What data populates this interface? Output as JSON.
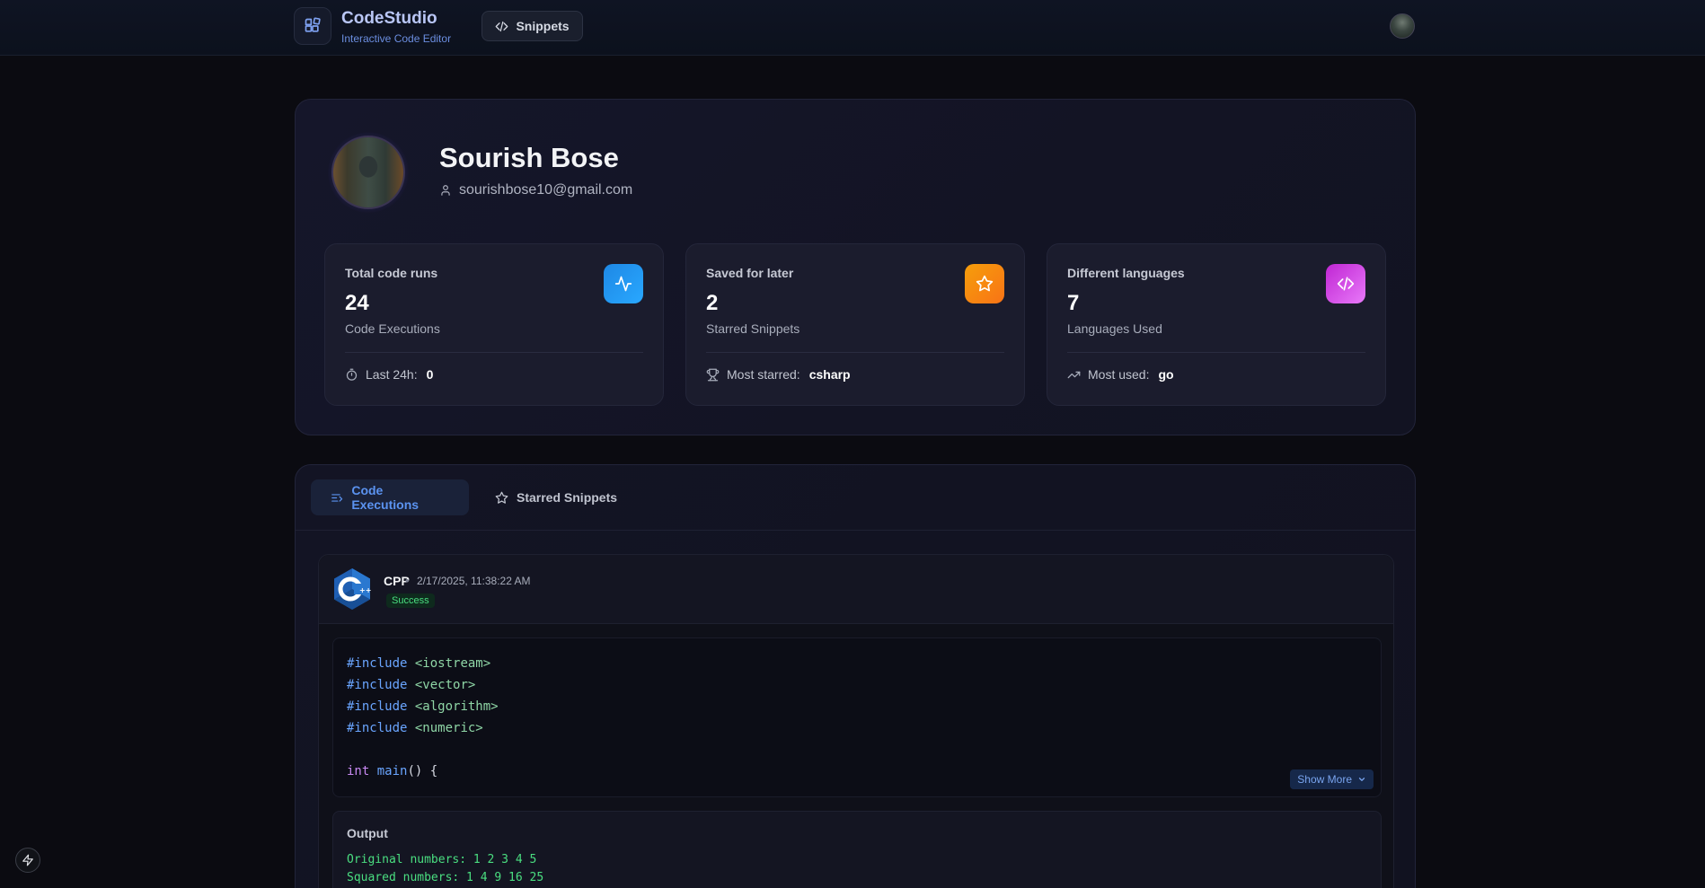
{
  "nav": {
    "brand_title": "CodeStudio",
    "brand_subtitle": "Interactive Code Editor",
    "snippets_label": "Snippets"
  },
  "profile": {
    "name": "Sourish Bose",
    "email": "sourishbose10@gmail.com"
  },
  "stats": [
    {
      "label": "Total code runs",
      "value": "24",
      "desc": "Code Executions",
      "foot_label": "Last 24h:",
      "foot_value": "0",
      "color": "#2196f3"
    },
    {
      "label": "Saved for later",
      "value": "2",
      "desc": "Starred Snippets",
      "foot_label": "Most starred:",
      "foot_value": "csharp",
      "color": "#f59e0b"
    },
    {
      "label": "Different languages",
      "value": "7",
      "desc": "Languages Used",
      "foot_label": "Most used:",
      "foot_value": "go",
      "color": "#d946ef"
    }
  ],
  "tabs": {
    "executions": "Code Executions",
    "starred": "Starred Snippets"
  },
  "execution": {
    "language": "CPP",
    "separator": "•",
    "timestamp": "2/17/2025, 11:38:22 AM",
    "status": "Success",
    "code": {
      "l1_kw": "#include",
      "l1_hdr": "<iostream>",
      "l2_kw": "#include",
      "l2_hdr": "<vector>",
      "l3_kw": "#include",
      "l3_hdr": "<algorithm>",
      "l4_kw": "#include",
      "l4_hdr": "<numeric>",
      "l6_type": "int",
      "l6_fn": "main",
      "l6_rest": "() {"
    },
    "show_more": "Show More",
    "output_title": "Output",
    "output_lines": [
      "Original numbers: 1 2 3 4 5",
      "Squared numbers: 1 4 9 16 25"
    ]
  }
}
